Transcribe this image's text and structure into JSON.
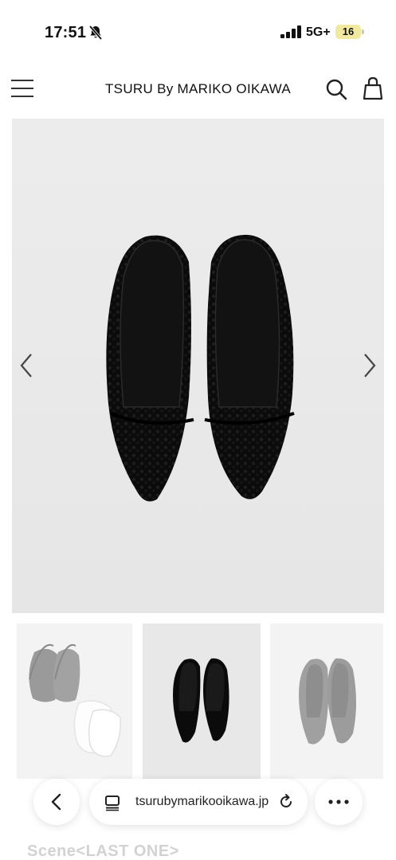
{
  "status_bar": {
    "time": "17:51",
    "network": "5G+",
    "battery": "16",
    "icons": [
      "bell-slash-icon",
      "signal-icon"
    ]
  },
  "header": {
    "brand": "TSURU By MARIKO OIKAWA",
    "icons": [
      "menu-icon",
      "search-icon",
      "shopping-bag-icon"
    ]
  },
  "gallery": {
    "icons": [
      "chevron-left-icon",
      "chevron-right-icon"
    ],
    "selected_thumbnail": 2
  },
  "browser": {
    "url": "tsurubymarikooikawa.jp",
    "icons": [
      "back-icon",
      "tabs-icon",
      "reload-icon",
      "more-icon"
    ]
  },
  "page": {
    "scene_text": "Scene<LAST ONE>"
  },
  "colors": {
    "battery_bg": "#f1e9a0",
    "hero_bg": "#ececec",
    "shoe": "#0d0d0d"
  }
}
